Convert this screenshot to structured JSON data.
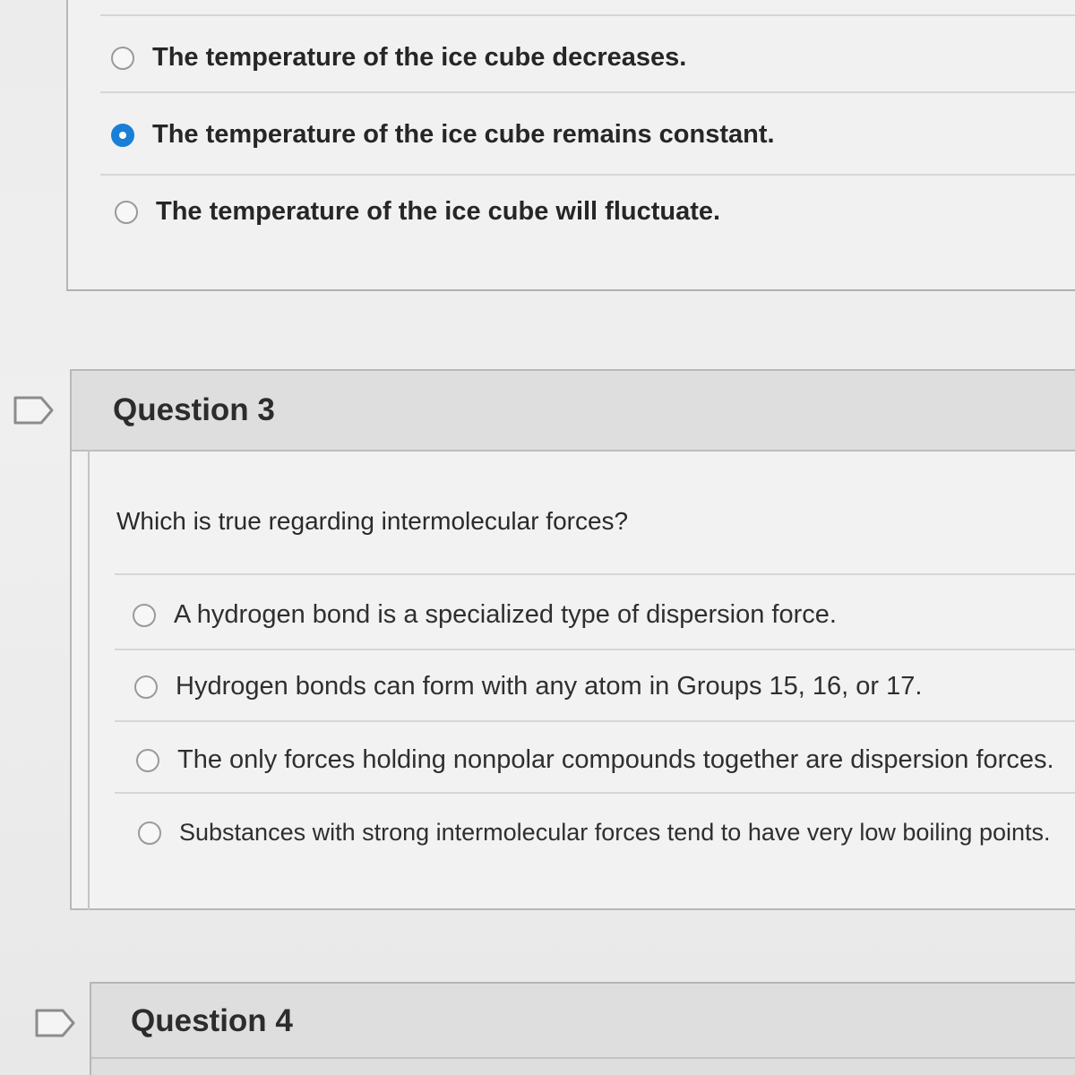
{
  "previous_question": {
    "options": [
      {
        "label": "The temperature of the ice cube decreases.",
        "selected": false
      },
      {
        "label": "The temperature of the ice cube remains constant.",
        "selected": true
      },
      {
        "label": "The temperature of the ice cube will fluctuate.",
        "selected": false
      }
    ]
  },
  "question3": {
    "title": "Question 3",
    "prompt": "Which is true regarding intermolecular forces?",
    "options": [
      {
        "label": "A hydrogen bond is a specialized type of dispersion force.",
        "selected": false
      },
      {
        "label": "Hydrogen bonds can form with any atom in Groups 15, 16, or 17.",
        "selected": false
      },
      {
        "label": "The only forces holding nonpolar compounds together are dispersion forces.",
        "selected": false
      },
      {
        "label": "Substances with strong intermolecular forces tend to have very low boiling points.",
        "selected": false
      }
    ]
  },
  "question4": {
    "title": "Question 4"
  },
  "colors": {
    "selected_radio": "#1a7fd6",
    "header_background": "#dedede",
    "card_background": "#f2f2f2"
  },
  "icons": {
    "flag": "flag-question-icon",
    "radio_selected": "radio-selected-icon",
    "radio_unselected": "radio-unselected-icon"
  }
}
